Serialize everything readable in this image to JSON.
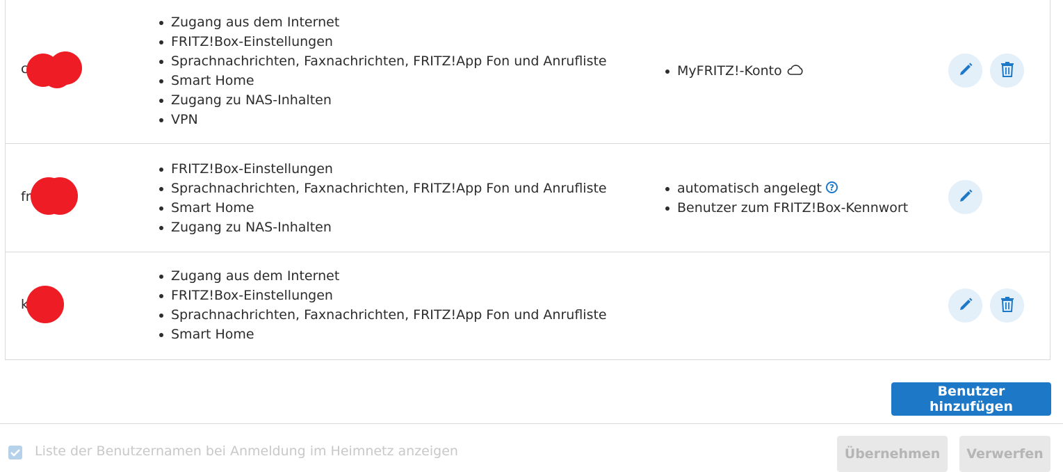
{
  "colors": {
    "accent": "#1e78c8",
    "accent_light": "#e3eff9",
    "redaction": "#ee1c24",
    "disabled_text": "#c8c8c8"
  },
  "users": [
    {
      "name_visible": "c",
      "permissions": [
        "Zugang aus dem Internet",
        "FRITZ!Box-Einstellungen",
        "Sprachnachrichten, Faxnachrichten, FRITZ!App Fon und Anrufliste",
        "Smart Home",
        "Zugang zu NAS-Inhalten",
        "VPN"
      ],
      "properties": [
        "MyFRITZ!-Konto"
      ],
      "property_icon": "cloud-icon",
      "actions": [
        "edit-icon",
        "trash-icon"
      ]
    },
    {
      "name_visible": "fr",
      "permissions": [
        "FRITZ!Box-Einstellungen",
        "Sprachnachrichten, Faxnachrichten, FRITZ!App Fon und Anrufliste",
        "Smart Home",
        "Zugang zu NAS-Inhalten"
      ],
      "properties": [
        "automatisch angelegt",
        "Benutzer zum FRITZ!Box-Kennwort"
      ],
      "property_icon": "help-icon",
      "help_glyph": "?",
      "actions": [
        "edit-icon"
      ]
    },
    {
      "name_visible": "k",
      "permissions": [
        "Zugang aus dem Internet",
        "FRITZ!Box-Einstellungen",
        "Sprachnachrichten, Faxnachrichten, FRITZ!App Fon und Anrufliste",
        "Smart Home"
      ],
      "properties": [],
      "actions": [
        "edit-icon",
        "trash-icon"
      ]
    }
  ],
  "add_user_button": "Benutzer hinzufügen",
  "footer": {
    "checkbox_label": "Liste der Benutzernamen bei Anmeldung im Heimnetz anzeigen",
    "checkbox_checked": true,
    "apply_label": "Übernehmen",
    "discard_label": "Verwerfen"
  }
}
